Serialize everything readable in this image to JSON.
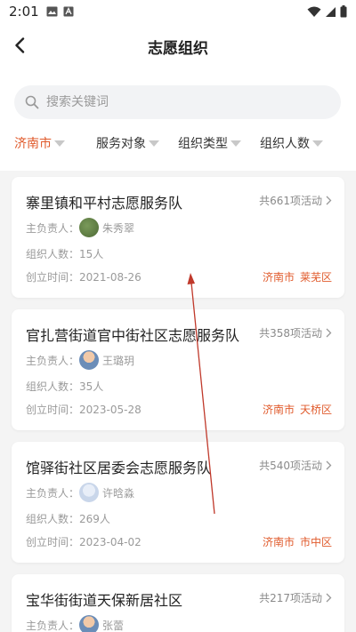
{
  "status_bar": {
    "time": "2:01"
  },
  "nav": {
    "title": "志愿组织"
  },
  "search": {
    "placeholder": "搜索关键词"
  },
  "filters": [
    {
      "label": "济南市",
      "active": true
    },
    {
      "label": "服务对象",
      "active": false
    },
    {
      "label": "组织类型",
      "active": false
    },
    {
      "label": "组织人数",
      "active": false
    }
  ],
  "labels": {
    "leader": "主负责人：",
    "members": "组织人数：",
    "created": "创立时间："
  },
  "orgs": [
    {
      "name": "寨里镇和平村志愿服务队",
      "activities": "共661项活动",
      "leader": "朱秀翠",
      "members": "15人",
      "created": "2021-08-26",
      "city": "济南市",
      "district": "莱芜区"
    },
    {
      "name": "官扎营街道官中街社区志愿服务队",
      "activities": "共358项活动",
      "leader": "王璐玥",
      "members": "35人",
      "created": "2023-05-28",
      "city": "济南市",
      "district": "天桥区"
    },
    {
      "name": "馆驿街社区居委会志愿服务队",
      "activities": "共540项活动",
      "leader": "许晗淼",
      "members": "269人",
      "created": "2023-04-02",
      "city": "济南市",
      "district": "市中区"
    },
    {
      "name": "宝华街街道天保新居社区",
      "activities": "共217项活动",
      "leader": "张蕾"
    }
  ],
  "colors": {
    "accent": "#e05a2b",
    "annotation": "#c0392b"
  }
}
